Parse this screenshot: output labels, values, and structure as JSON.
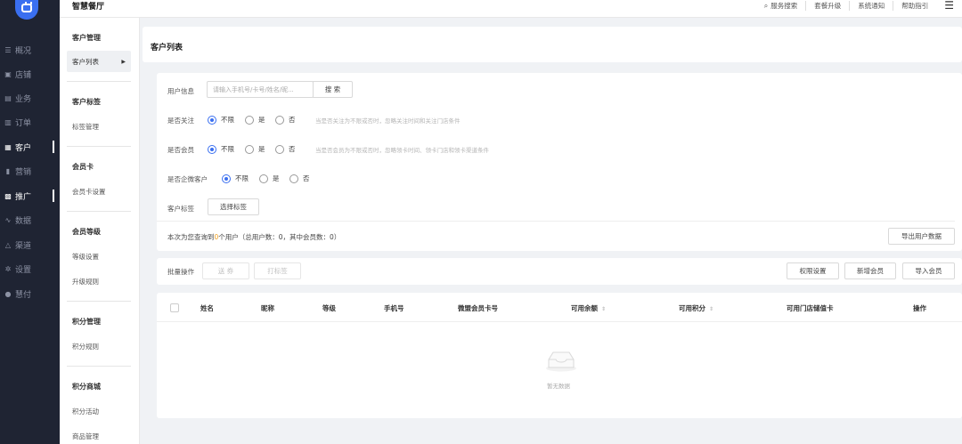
{
  "app": {
    "title": "智慧餐厅"
  },
  "header": {
    "links": [
      "服务搜索",
      "套餐升级",
      "系统通知",
      "帮助指引"
    ]
  },
  "main_nav": [
    {
      "icon": "☰",
      "label": "概况"
    },
    {
      "icon": "▣",
      "label": "店铺"
    },
    {
      "icon": "▤",
      "label": "业务"
    },
    {
      "icon": "▥",
      "label": "订单"
    },
    {
      "icon": "▦",
      "label": "客户"
    },
    {
      "icon": "▮",
      "label": "营销"
    },
    {
      "icon": "▩",
      "label": "推广"
    },
    {
      "icon": "∿",
      "label": "数据"
    },
    {
      "icon": "△",
      "label": "渠道"
    },
    {
      "icon": "✲",
      "label": "设置"
    },
    {
      "icon": "●",
      "label": "慧付"
    }
  ],
  "sub_nav": {
    "g1": "客户管理",
    "g1_item": "客户列表",
    "g2": "客户标签",
    "g2_item": "标签管理",
    "g3": "会员卡",
    "g3_item": "会员卡设置",
    "g4": "会员等级",
    "g4_item1": "等级设置",
    "g4_item2": "升级规则",
    "g5": "积分管理",
    "g5_item": "积分规则",
    "g6": "积分商城",
    "g6_item1": "积分活动",
    "g6_item2": "商品管理"
  },
  "page": {
    "title": "客户列表"
  },
  "filters": {
    "user_info_label": "用户信息",
    "search_placeholder": "请输入手机号/卡号/姓名/昵...",
    "search_button": "搜 索",
    "follow_label": "是否关注",
    "follow_options": [
      "不限",
      "是",
      "否"
    ],
    "follow_hint": "当是否关注为不限或否时，忽略关注时间和关注门店条件",
    "member_label": "是否会员",
    "member_options": [
      "不限",
      "是",
      "否"
    ],
    "member_hint": "当是否会员为不限或否时，忽略领卡时间、领卡门店和领卡渠道条件",
    "wecom_label": "是否企微客户",
    "wecom_options": [
      "不限",
      "是",
      "否"
    ],
    "tag_label": "客户标签",
    "tag_button": "选择标签",
    "summary_prefix": "本次为您查询到",
    "summary_count": "0",
    "summary_suffix": "个用户（总用户数：0，其中会员数：0）",
    "export_button": "导出用户数据"
  },
  "toolbar": {
    "batch_label": "批量操作",
    "send_coupon": "送 券",
    "tag_action": "打标签",
    "permission": "权限设置",
    "add_member": "新增会员",
    "import_member": "导入会员"
  },
  "table": {
    "columns": [
      "姓名",
      "昵称",
      "等级",
      "手机号",
      "微盟会员卡号",
      "可用余额",
      "可用积分",
      "可用门店储值卡",
      "操作"
    ],
    "empty_text": "暂无数据"
  },
  "colors": {
    "accent": "#3a6ff0",
    "sidebar": "#1f2433"
  }
}
